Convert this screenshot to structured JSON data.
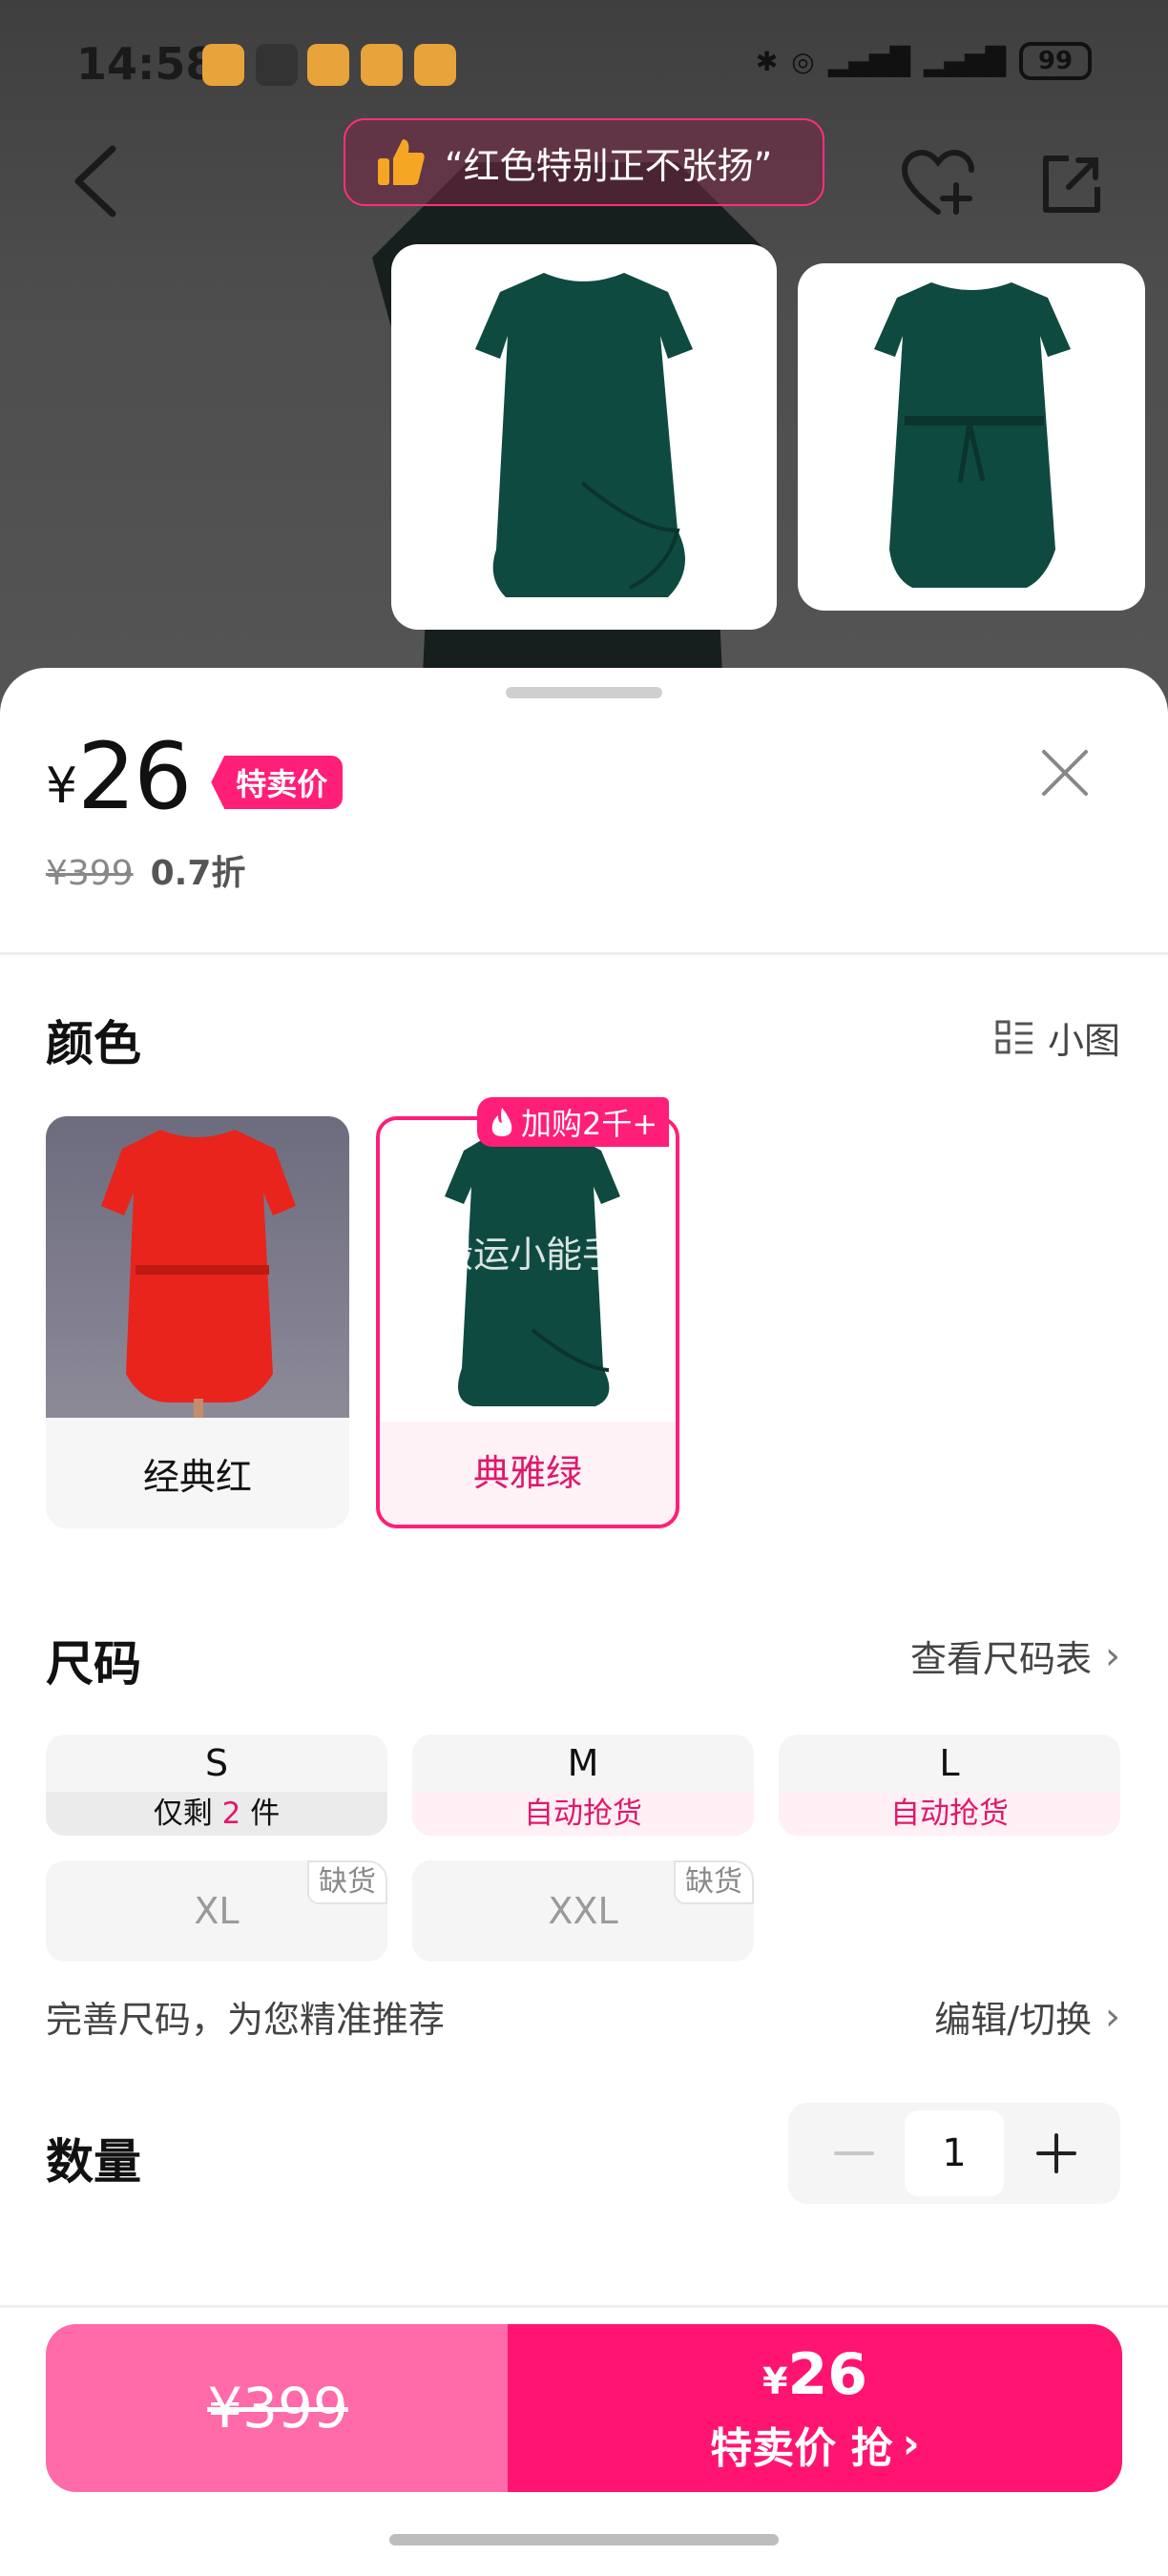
{
  "status_bar": {
    "time": "14:58",
    "battery": "99"
  },
  "header": {
    "quote": "“红色特别正不张扬”"
  },
  "price": {
    "currency": "¥",
    "current": "26",
    "tag": "特卖价",
    "original": "¥399",
    "discount": "0.7折"
  },
  "color_section": {
    "title": "颜色",
    "view_toggle": "小图",
    "options": [
      {
        "label": "经典红",
        "color": "#e8241c"
      },
      {
        "label": "典雅绿",
        "color": "#0f4a40",
        "badge": "加购2千+",
        "watermark": "搬运小能手"
      }
    ],
    "selected": "典雅绿"
  },
  "size_section": {
    "title": "尺码",
    "chart_link": "查看尺码表",
    "sizes": [
      {
        "size": "S",
        "note_prefix": "仅剩",
        "note_num": "2",
        "note_suffix": "件"
      },
      {
        "size": "M",
        "note": "自动抢货"
      },
      {
        "size": "L",
        "note": "自动抢货"
      },
      {
        "size": "XL",
        "tag": "缺货"
      },
      {
        "size": "XXL",
        "tag": "缺货"
      }
    ],
    "hint": "完善尺码，为您精准推荐",
    "edit_link": "编辑/切换"
  },
  "quantity": {
    "title": "数量",
    "value": "1"
  },
  "bottom": {
    "original": "¥399",
    "buy_currency": "¥",
    "buy_price": "26",
    "buy_label": "特卖价 抢"
  },
  "colors": {
    "accent": "#ff1472",
    "accent_light": "#ff6aa8",
    "dress_green": "#0f4a40"
  }
}
